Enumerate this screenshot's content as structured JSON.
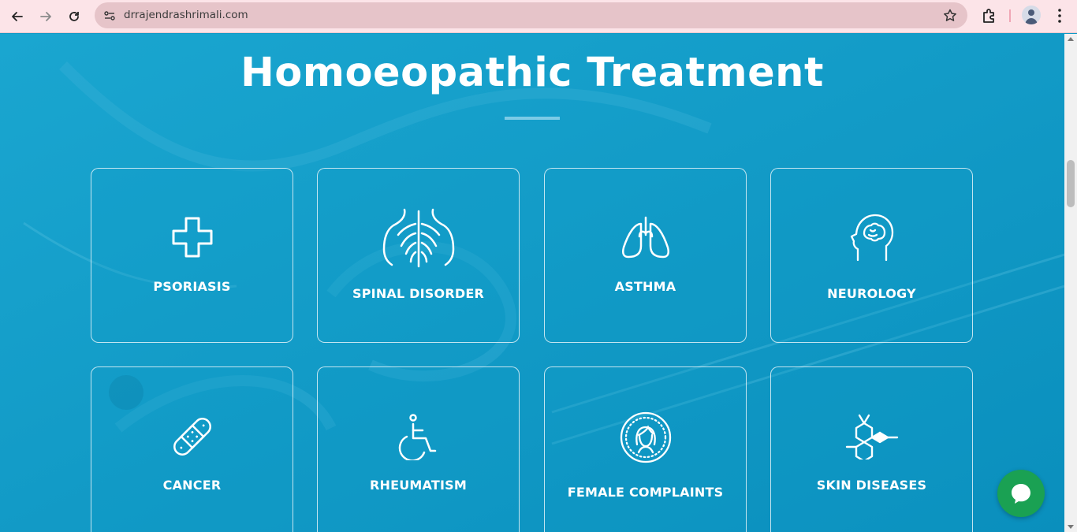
{
  "browser": {
    "url": "drrajendrashrimali.com",
    "icons": [
      "back-icon",
      "forward-icon",
      "reload-icon",
      "site-settings-icon",
      "bookmark-star-icon",
      "extensions-icon",
      "profile-avatar",
      "more-menu-icon"
    ]
  },
  "page": {
    "title": "Homoeopathic Treatment",
    "colors": {
      "background": "#0e9ac7",
      "text": "#ffffff",
      "chat": "#1aa153"
    },
    "treatments": [
      {
        "label": "PSORIASIS",
        "icon": "medical-cross-icon"
      },
      {
        "label": "SPINAL DISORDER",
        "icon": "spine-ribs-icon"
      },
      {
        "label": "ASTHMA",
        "icon": "lungs-icon"
      },
      {
        "label": "NEUROLOGY",
        "icon": "brain-head-icon"
      },
      {
        "label": "CANCER",
        "icon": "bandage-icon"
      },
      {
        "label": "RHEUMATISM",
        "icon": "wheelchair-icon"
      },
      {
        "label": "FEMALE COMPLAINTS",
        "icon": "female-face-icon"
      },
      {
        "label": "SKIN DISEASES",
        "icon": "molecule-icon"
      }
    ]
  },
  "chat_widget": {
    "icon": "chat-bubble-icon"
  }
}
